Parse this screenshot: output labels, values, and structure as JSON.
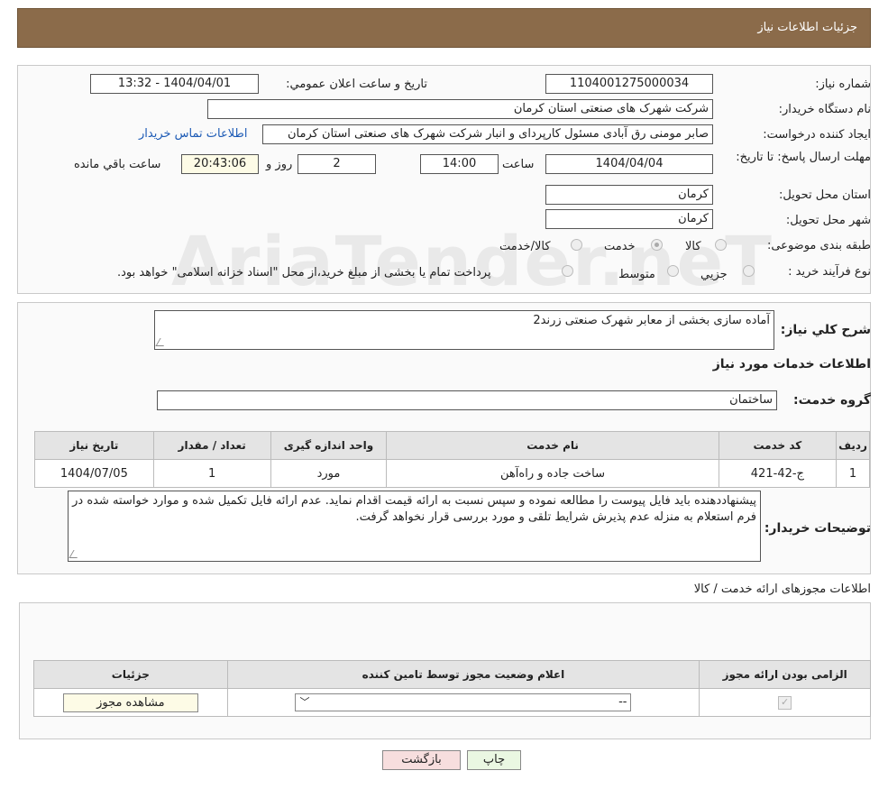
{
  "header": {
    "title": "جزئیات اطلاعات نیاز"
  },
  "labels": {
    "need_number": "شماره نیاز:",
    "announce_datetime": "تاریخ و ساعت اعلان عمومي:",
    "buyer_org": "نام دستگاه خريدار:",
    "creator": "ايجاد كننده درخواست:",
    "deadline": "مهلت ارسال پاسخ: تا تاریخ:",
    "time_word": "ساعت",
    "day_and": "روز و",
    "remaining": "ساعت باقي مانده",
    "delivery_province": "استان محل تحويل:",
    "delivery_city": "شهر محل تحويل:",
    "category": "طبقه بندی موضوعی:",
    "purchase_type": "نوع فرآيند خريد :",
    "general_desc": "شرح کلي نياز:",
    "services_info": "اطلاعات خدمات مورد نياز",
    "service_group": "گروه خدمت:",
    "buyer_notes": "توضيحات خريدار:",
    "permits_title": "اطلاعات مجوزهای ارائه خدمت / کالا"
  },
  "values": {
    "need_number": "1104001275000034",
    "announce_datetime": "1404/04/01 - 13:32",
    "buyer_org": "شرکت شهرک های صنعتی استان کرمان",
    "creator": "صابر مومنی رق آبادی مسئول کارپردای و انبار شرکت شهرک های صنعتی استان کرمان",
    "contact_link": "اطلاعات تماس خريدار",
    "deadline_date": "1404/04/04",
    "deadline_time": "14:00",
    "days": "2",
    "remaining_time": "20:43:06",
    "province": "کرمان",
    "city": "کرمان",
    "general_desc": "آماده سازی بخشی از معابر شهرک صنعتی زرند2",
    "service_group": "ساختمان",
    "buyer_notes": "پیشنهاددهنده باید فایل پیوست را مطالعه نموده و سپس نسبت به ارائه قیمت اقدام نماید. عدم ارائه فایل تکمیل شده و موارد خواسته شده در فرم استعلام به منزله عدم پذیرش شرایط تلقی و مورد بررسی قرار نخواهد گرفت."
  },
  "category_options": [
    {
      "label": "کالا",
      "checked": false
    },
    {
      "label": "خدمت",
      "checked": true
    },
    {
      "label": "کالا/خدمت",
      "checked": false
    }
  ],
  "purchase_options": [
    {
      "label": "جزيي",
      "checked": false
    },
    {
      "label": "متوسط",
      "checked": false
    }
  ],
  "purchase_note": "پرداخت تمام يا بخشی از مبلغ خريد،از محل \"اسناد خزانه اسلامی\" خواهد بود.",
  "services_table": {
    "headers": [
      "رديف",
      "کد خدمت",
      "نام خدمت",
      "واحد اندازه گيری",
      "تعداد / مقدار",
      "تاريخ نياز"
    ],
    "rows": [
      [
        "1",
        "ج-42-421",
        "ساخت جاده و راه‌آهن",
        "مورد",
        "1",
        "1404/07/05"
      ]
    ]
  },
  "permits_table": {
    "headers": [
      "الزامی بودن ارائه مجوز",
      "اعلام وضعيت مجوز توسط تامين کننده",
      "جزئيات"
    ],
    "select_value": "--",
    "view_button": "مشاهده مجوز"
  },
  "buttons": {
    "print": "چاپ",
    "back": "بازگشت"
  },
  "watermark": "AriaTender.neT",
  "colors": {
    "header_bg": "#8b6b4a",
    "back_button_bg": "#f7dede",
    "print_button_bg": "#eaf7e2",
    "view_button_bg": "#fdfbe6"
  }
}
